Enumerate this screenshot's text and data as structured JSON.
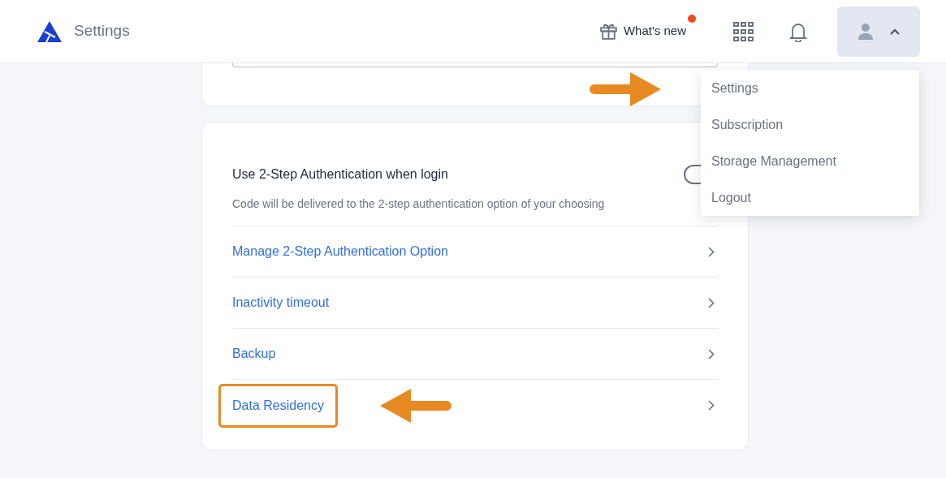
{
  "header": {
    "title": "Settings",
    "whats_new": {
      "label": "What's new",
      "unread": true
    }
  },
  "user_menu": {
    "expanded": true,
    "items": [
      {
        "label": "Settings"
      },
      {
        "label": "Subscription"
      },
      {
        "label": "Storage Management"
      },
      {
        "label": "Logout"
      }
    ]
  },
  "security_card": {
    "two_step": {
      "label": "Use 2-Step Authentication when login",
      "description": "Code will be delivered to the 2-step authentication option of your choosing",
      "on": false
    },
    "links": [
      {
        "label": "Manage 2-Step Authentication Option",
        "highlighted": false
      },
      {
        "label": "Inactivity timeout",
        "highlighted": false
      },
      {
        "label": "Backup",
        "highlighted": false
      },
      {
        "label": "Data Residency",
        "highlighted": true
      }
    ]
  }
}
